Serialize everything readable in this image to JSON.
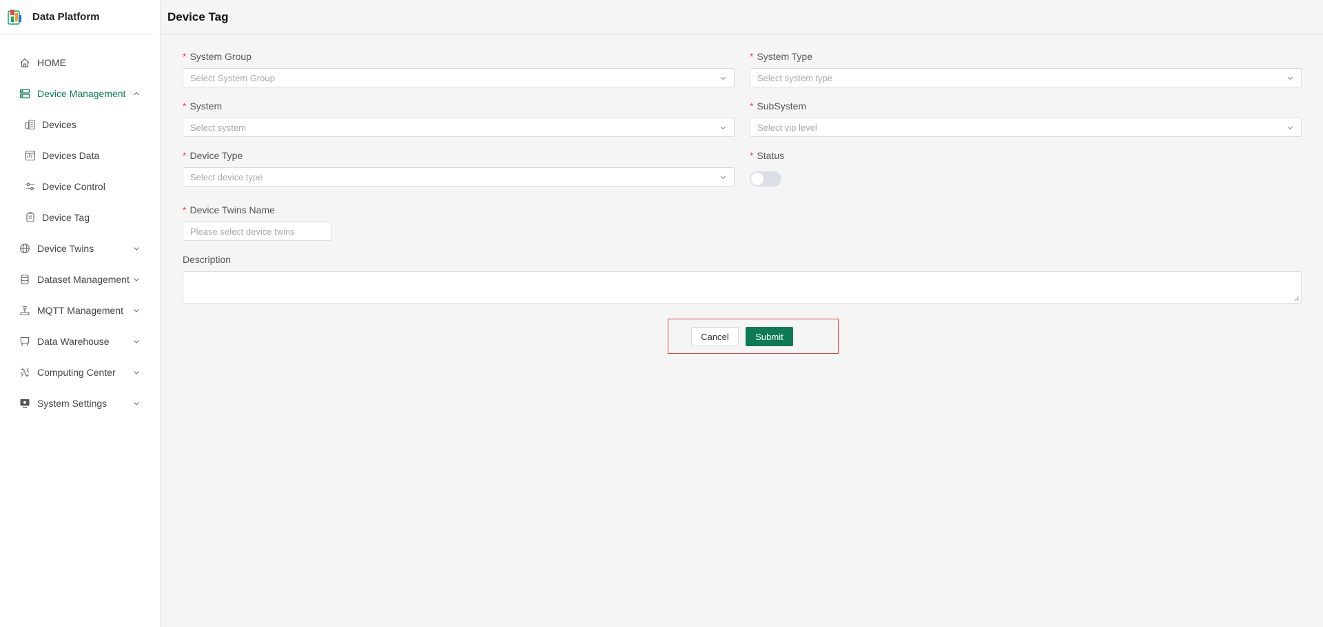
{
  "app": {
    "title": "Data Platform"
  },
  "colors": {
    "accent": "#0e7a55",
    "required": "#e84545",
    "highlight": "#e23a3a"
  },
  "sidebar": {
    "items": [
      {
        "label": "HOME",
        "icon": "home-icon"
      },
      {
        "label": "Device Management",
        "icon": "server-icon",
        "expanded": true
      },
      {
        "label": "Devices",
        "icon": "devices-icon"
      },
      {
        "label": "Devices Data",
        "icon": "chart-doc-icon"
      },
      {
        "label": "Device Control",
        "icon": "sliders-icon"
      },
      {
        "label": "Device Tag",
        "icon": "tag-icon"
      },
      {
        "label": "Device Twins",
        "icon": "globe-icon"
      },
      {
        "label": "Dataset Management",
        "icon": "database-icon"
      },
      {
        "label": "MQTT Management",
        "icon": "antenna-icon"
      },
      {
        "label": "Data Warehouse",
        "icon": "easel-icon"
      },
      {
        "label": "Computing Center",
        "icon": "compute-icon"
      },
      {
        "label": "System Settings",
        "icon": "monitor-icon"
      }
    ]
  },
  "header": {
    "title": "Device Tag"
  },
  "form": {
    "system_group": {
      "label": "System Group",
      "placeholder": "Select System Group"
    },
    "system_type": {
      "label": "System Type",
      "placeholder": "Select system type"
    },
    "system": {
      "label": "System",
      "placeholder": "Select system"
    },
    "subsystem": {
      "label": "SubSystem",
      "placeholder": "Select vip level"
    },
    "device_type": {
      "label": "Device Type",
      "placeholder": "Select device type"
    },
    "status": {
      "label": "Status",
      "on": false
    },
    "twins_name": {
      "label": "Device Twins Name",
      "placeholder": "Please select device twins"
    },
    "description": {
      "label": "Description"
    },
    "required_mark": "*"
  },
  "actions": {
    "cancel": "Cancel",
    "submit": "Submit"
  }
}
